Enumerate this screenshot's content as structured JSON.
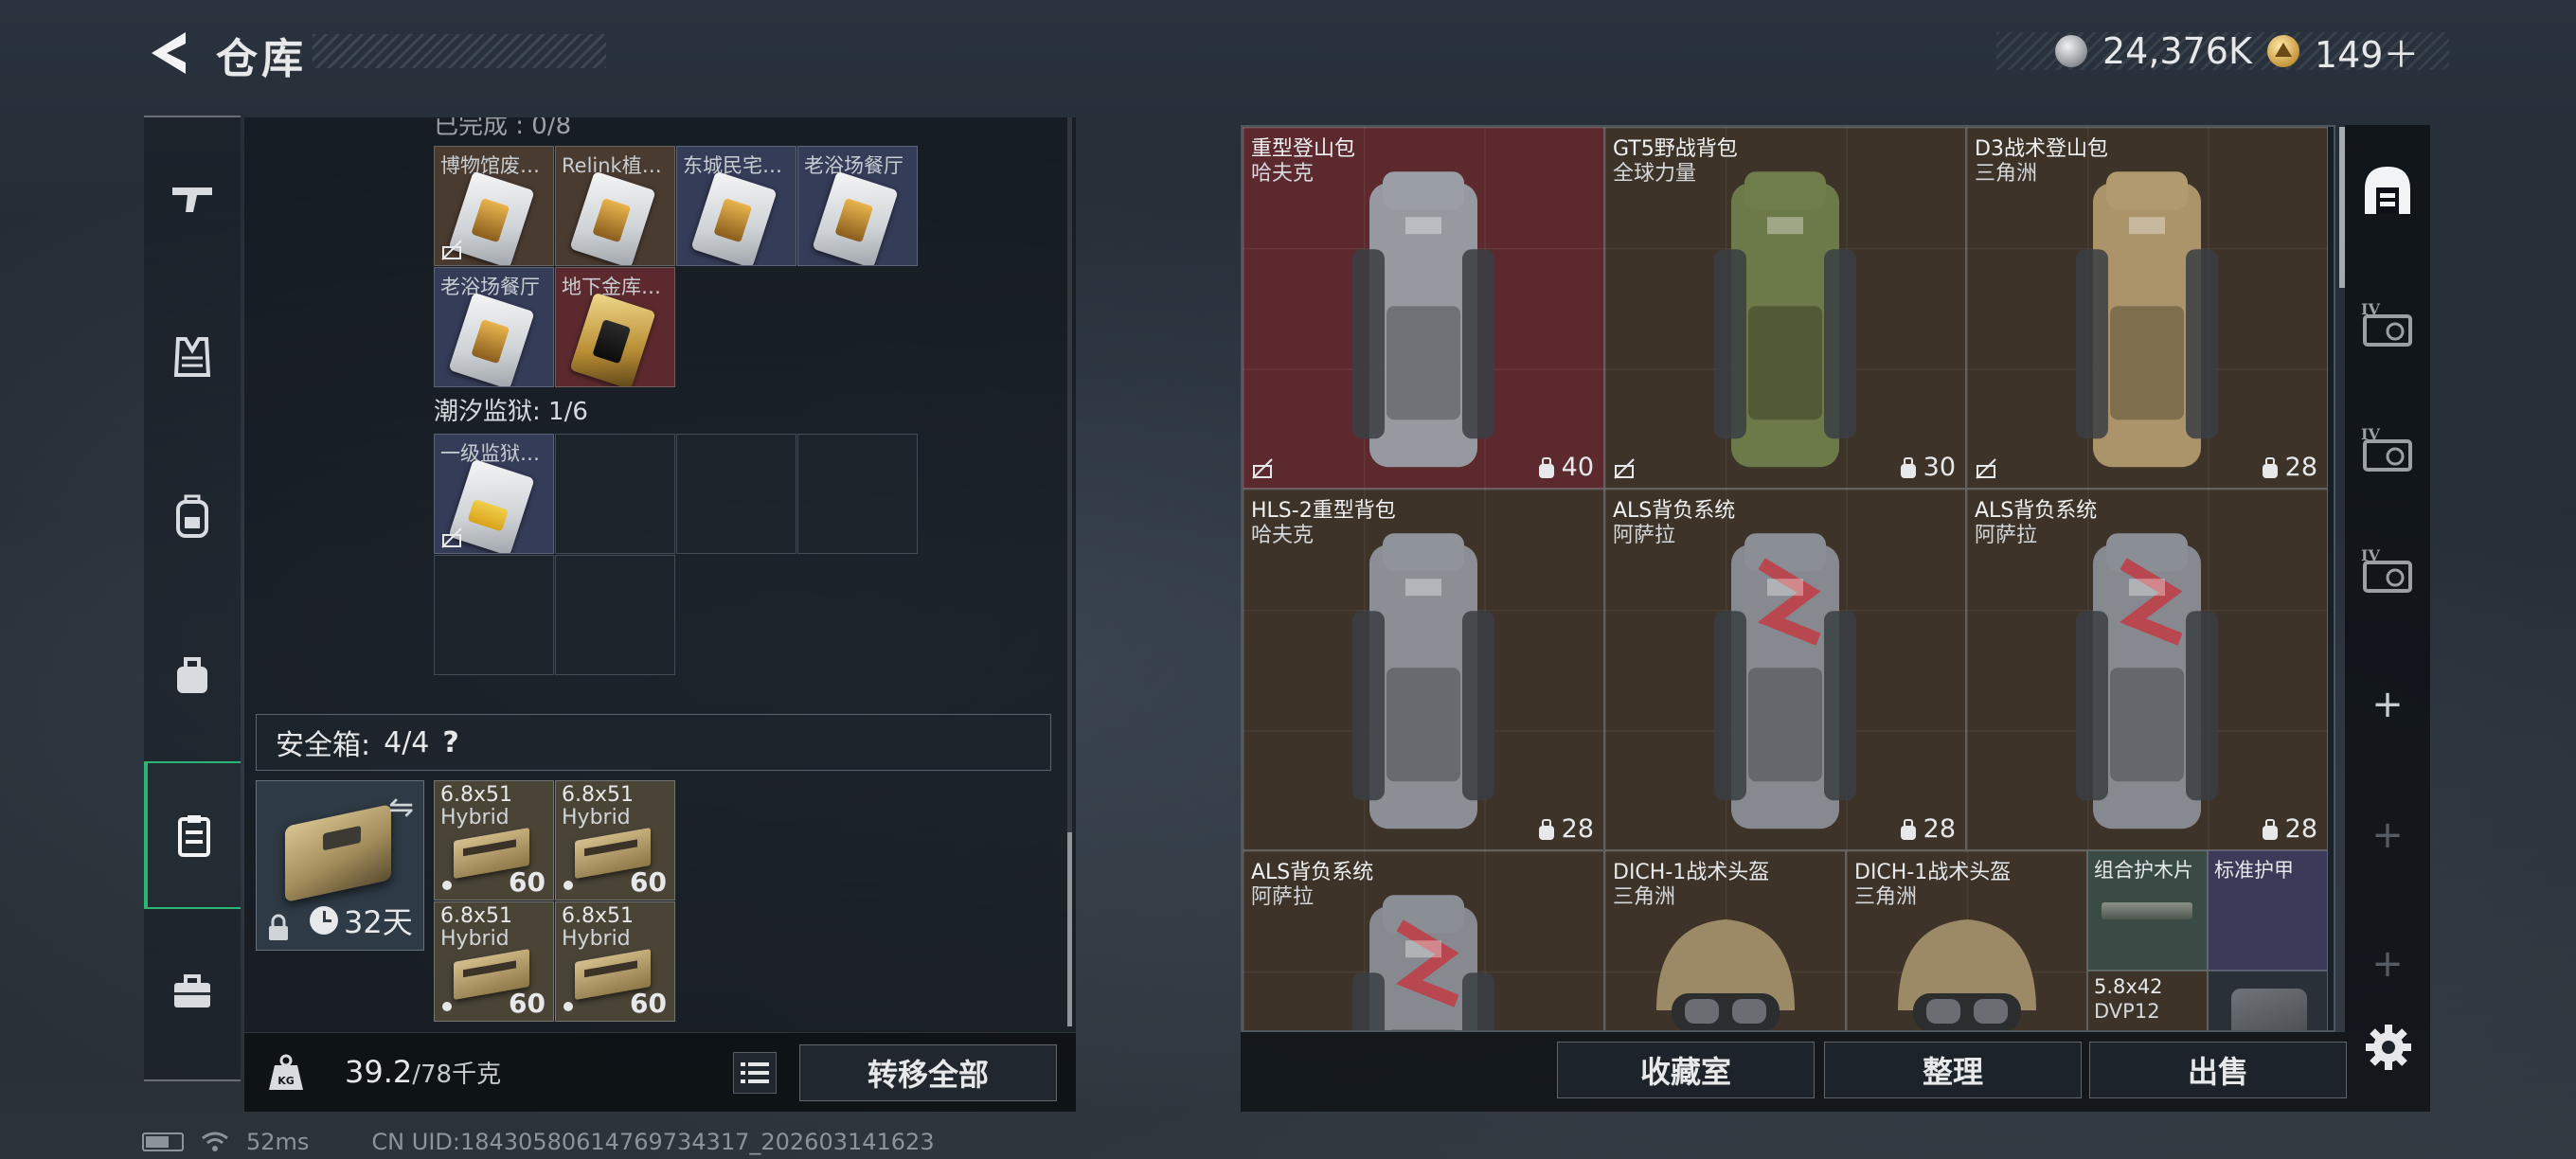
{
  "header": {
    "title": "仓库",
    "currency_silver": "24,376K",
    "currency_gold": "149＋"
  },
  "nav": {
    "items": [
      "weapon-icon",
      "vest-icon",
      "backpack-icon",
      "pouch-icon",
      "safebox-icon",
      "briefcase-icon"
    ],
    "active": "safebox-icon"
  },
  "left": {
    "cut_section_label": "已完成 : 0/8",
    "keycards_row1": [
      "博物馆废…",
      "Relink植…",
      "东城民宅…",
      "老浴场餐厅"
    ],
    "keycards_row2": [
      "老浴场餐厅",
      "地下金库…"
    ],
    "tidal_label": "潮汐监狱: 1/6",
    "tidal_item": "一级监狱…",
    "safebox_title": "安全箱:",
    "safebox_count": "4/4",
    "safebox_help": "?",
    "safebox_timer": "32天",
    "ammo": [
      {
        "cal": "6.8x51",
        "type": "Hybrid",
        "count": "60"
      },
      {
        "cal": "6.8x51",
        "type": "Hybrid",
        "count": "60"
      },
      {
        "cal": "6.8x51",
        "type": "Hybrid",
        "count": "60"
      },
      {
        "cal": "6.8x51",
        "type": "Hybrid",
        "count": "60"
      }
    ],
    "weight_current": "39.2",
    "weight_cap": "/78千克",
    "transfer_all": "转移全部"
  },
  "right": {
    "items": [
      {
        "name": "重型登山包",
        "brand": "哈夫克",
        "capacity": "40",
        "bg": "red",
        "color": "#9a9fa6"
      },
      {
        "name": "GT5野战背包",
        "brand": "全球力量",
        "capacity": "30",
        "bg": "brown",
        "color": "#6f7d4a"
      },
      {
        "name": "D3战术登山包",
        "brand": "三角洲",
        "capacity": "28",
        "bg": "brown",
        "color": "#b19a6e"
      },
      {
        "name": "HLS-2重型背包",
        "brand": "哈夫克",
        "capacity": "28",
        "bg": "brown",
        "color": "#8f949b"
      },
      {
        "name": "ALS背负系统",
        "brand": "阿萨拉",
        "capacity": "28",
        "bg": "brown",
        "color": "#8a8f96"
      },
      {
        "name": "ALS背负系统",
        "brand": "阿萨拉",
        "capacity": "28",
        "bg": "brown",
        "color": "#8a8f96"
      },
      {
        "name": "ALS背负系统",
        "brand": "阿萨拉",
        "capacity": "",
        "bg": "brown",
        "color": "#8a8f96"
      }
    ],
    "helmets": [
      {
        "name": "DICH-1战术头盔",
        "brand": "三角洲"
      },
      {
        "name": "DICH-1战术头盔",
        "brand": "三角洲"
      }
    ],
    "small_items": [
      {
        "name": "组合护木片",
        "sub": ""
      },
      {
        "name": "标准护甲",
        "sub": ""
      },
      {
        "name": "5.8x42",
        "sub": "DVP12"
      }
    ],
    "buttons": [
      "收藏室",
      "整理",
      "出售"
    ]
  },
  "status": {
    "ping": "52ms",
    "uid": "CN UID:18430580614769734317_202603141623"
  },
  "colors": {
    "accent_green": "#2bb673",
    "red_cell": "#5c2a2e",
    "brown_cell": "#3e3329"
  }
}
